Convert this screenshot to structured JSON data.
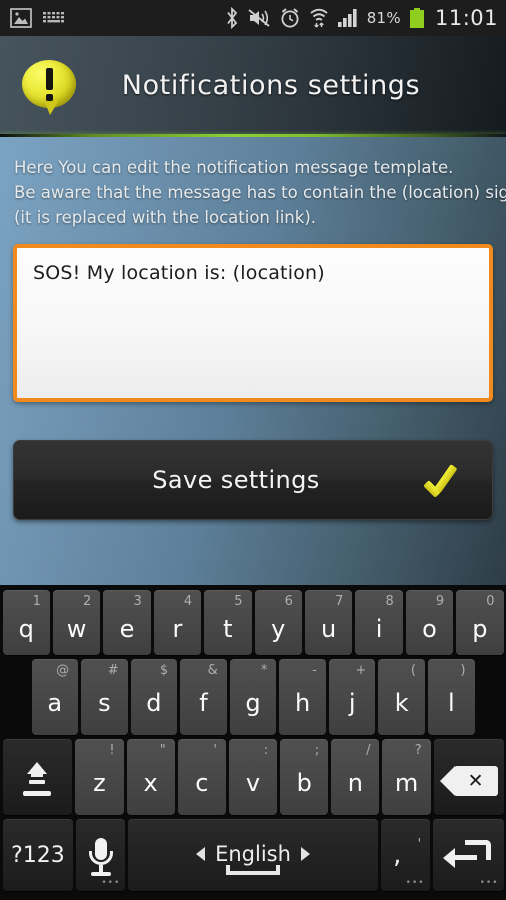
{
  "statusbar": {
    "left_icons": [
      "image-icon",
      "keyboard-icon"
    ],
    "right_icons": [
      "bluetooth-icon",
      "sound-mute-icon",
      "alarm-icon",
      "wifi-icon",
      "signal-icon"
    ],
    "battery_percent": "81%",
    "battery_icon": "battery-icon",
    "clock": "11:01"
  },
  "header": {
    "icon": "notification-bubble-icon",
    "title": "Notifications settings"
  },
  "content": {
    "description_lines": [
      "Here You can edit the notification message template.",
      "Be aware that the message has to contain the (location) sign",
      "(it is replaced with the location link)."
    ],
    "message_field": {
      "value": "SOS! My location is: (location)",
      "placeholder": "",
      "border_color": "#f08a1c"
    },
    "save_button": {
      "label": "Save settings",
      "icon": "checkmark-icon",
      "icon_color": "#e6e024"
    }
  },
  "keyboard": {
    "row1": [
      {
        "main": "q",
        "alt": "1"
      },
      {
        "main": "w",
        "alt": "2"
      },
      {
        "main": "e",
        "alt": "3"
      },
      {
        "main": "r",
        "alt": "4"
      },
      {
        "main": "t",
        "alt": "5"
      },
      {
        "main": "y",
        "alt": "6"
      },
      {
        "main": "u",
        "alt": "7"
      },
      {
        "main": "i",
        "alt": "8"
      },
      {
        "main": "o",
        "alt": "9"
      },
      {
        "main": "p",
        "alt": "0"
      }
    ],
    "row2": [
      {
        "main": "a",
        "alt": "@"
      },
      {
        "main": "s",
        "alt": "#"
      },
      {
        "main": "d",
        "alt": "$"
      },
      {
        "main": "f",
        "alt": "&"
      },
      {
        "main": "g",
        "alt": "*"
      },
      {
        "main": "h",
        "alt": "-"
      },
      {
        "main": "j",
        "alt": "+"
      },
      {
        "main": "k",
        "alt": "("
      },
      {
        "main": "l",
        "alt": ")"
      }
    ],
    "row3": [
      {
        "main": "z",
        "alt": "!"
      },
      {
        "main": "x",
        "alt": "\""
      },
      {
        "main": "c",
        "alt": "'"
      },
      {
        "main": "v",
        "alt": ":"
      },
      {
        "main": "b",
        "alt": ";"
      },
      {
        "main": "n",
        "alt": "/"
      },
      {
        "main": "m",
        "alt": "?"
      }
    ],
    "shift_key": "shift-icon",
    "backspace_key": "backspace-icon",
    "symbols_key": "?123",
    "mic_key": "microphone-icon",
    "space_key": {
      "language": "English",
      "prev_icon": "triangle-left-icon",
      "next_icon": "triangle-right-icon"
    },
    "period_key": {
      "main": ",",
      "alt": "'"
    },
    "enter_key": "enter-icon"
  }
}
